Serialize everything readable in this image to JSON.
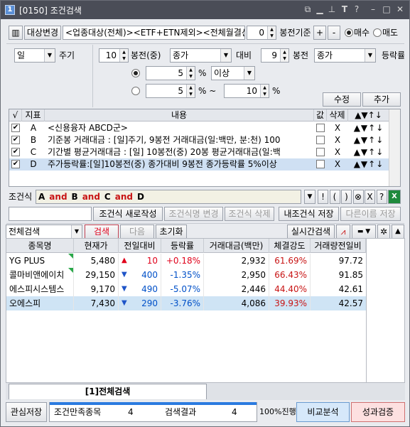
{
  "window": {
    "code": "[0150]",
    "title": "조건검색",
    "app_icon": "1"
  },
  "toolbar": {
    "target_change": "대상변경",
    "target_text": "<업종대상(전체)><ETF+ETN제외><전체월결산>",
    "bong_value": "0",
    "bong_basis": "봉전기준",
    "plus": "+",
    "minus": "-",
    "buy": "매수",
    "sell": "매도"
  },
  "condition_editor": {
    "period_select": "일",
    "period_label": "주기",
    "n_bong1": "10",
    "bong_mid_label": "봉전(중)",
    "price_select1": "종가",
    "compare_label": "대비",
    "n_bong2": "9",
    "bong_label2": "봉전",
    "price_select2": "종가",
    "rate_label": "등락률",
    "value1": "5",
    "percent1": "%",
    "above_select": "이상",
    "value2": "5",
    "percent_tilde": "% ~",
    "value3": "10",
    "percent3": "%",
    "modify": "수정",
    "add": "추가"
  },
  "condition_grid": {
    "headers": [
      "√",
      "지표",
      "내용",
      "값",
      "삭제",
      "▲▼↑↓"
    ],
    "rows": [
      {
        "checked": "✔",
        "id": "A",
        "content": "<신용융자 ABCD군>",
        "del": "X",
        "arrows": "▲▼↑↓"
      },
      {
        "checked": "✔",
        "id": "B",
        "content": "기준봉 거래대금 : [일]주기, 9봉전 거래대금(일:백만, 분:천) 100",
        "del": "X",
        "arrows": "▲▼↑↓"
      },
      {
        "checked": "✔",
        "id": "C",
        "content": "기간별 평균거래대금 : [일] 10봉전(중) 20봉 평균거래대금(일:백",
        "del": "X",
        "arrows": "▲▼↑↓"
      },
      {
        "checked": "✔",
        "id": "D",
        "content": "주가등락률:[일]10봉전(중) 종가대비 9봉전 종가등락률 5%이상",
        "del": "X",
        "arrows": "▲▼↑↓"
      }
    ]
  },
  "formula": {
    "label": "조건식",
    "tokens": [
      {
        "text": "A",
        "kind": "id"
      },
      {
        "text": "and",
        "kind": "op"
      },
      {
        "text": "B",
        "kind": "id"
      },
      {
        "text": "and",
        "kind": "op"
      },
      {
        "text": "C",
        "kind": "id"
      },
      {
        "text": "and",
        "kind": "op"
      },
      {
        "text": "D",
        "kind": "id"
      }
    ],
    "buttons": [
      "!",
      "(",
      ")",
      "⊗",
      "X",
      "?"
    ]
  },
  "actions": {
    "name_input": "",
    "new": "조건식 새로작성",
    "change": "조건식명 변경",
    "delete": "조건식 삭제",
    "save_mine": "내조건식 저장",
    "save_as": "다른이름 저장"
  },
  "search_bar": {
    "scope": "전체검색",
    "search": "검색",
    "next": "다음",
    "reset": "초기화",
    "realtime": "실시간검색"
  },
  "result_grid": {
    "headers": [
      "종목명",
      "현재가",
      "전일대비",
      "등락률",
      "거래대금(백만)",
      "체결강도",
      "거래량전일비"
    ],
    "rows": [
      {
        "name": "YG PLUS",
        "price": "5,480",
        "dir": "up",
        "diff": "10",
        "rate": "+0.18%",
        "amount": "2,932",
        "strength": "61.69%",
        "volratio": "97.72"
      },
      {
        "name": "콜마비앤에이치",
        "price": "29,150",
        "dir": "down",
        "diff": "400",
        "rate": "-1.35%",
        "amount": "2,950",
        "strength": "66.43%",
        "volratio": "91.85"
      },
      {
        "name": "에스피시스템스",
        "price": "9,170",
        "dir": "down",
        "diff": "490",
        "rate": "-5.07%",
        "amount": "2,446",
        "strength": "44.40%",
        "volratio": "42.61"
      },
      {
        "name": "오에스피",
        "price": "7,430",
        "dir": "down",
        "diff": "290",
        "rate": "-3.76%",
        "amount": "4,086",
        "strength": "39.93%",
        "volratio": "42.57"
      }
    ]
  },
  "tabs": {
    "active": "[1]전체검색"
  },
  "status": {
    "watch_save": "관심저장",
    "satisfied_label": "조건만족종목",
    "satisfied_count": "4",
    "result_label": "검색결과",
    "result_count": "4",
    "progress": "100%진행",
    "progress_percent": 100,
    "compare": "비교분석",
    "verify": "성과검증"
  },
  "colors": {
    "up": "#e0001a",
    "down": "#0050c8",
    "titlebar": "#4a4d57"
  }
}
